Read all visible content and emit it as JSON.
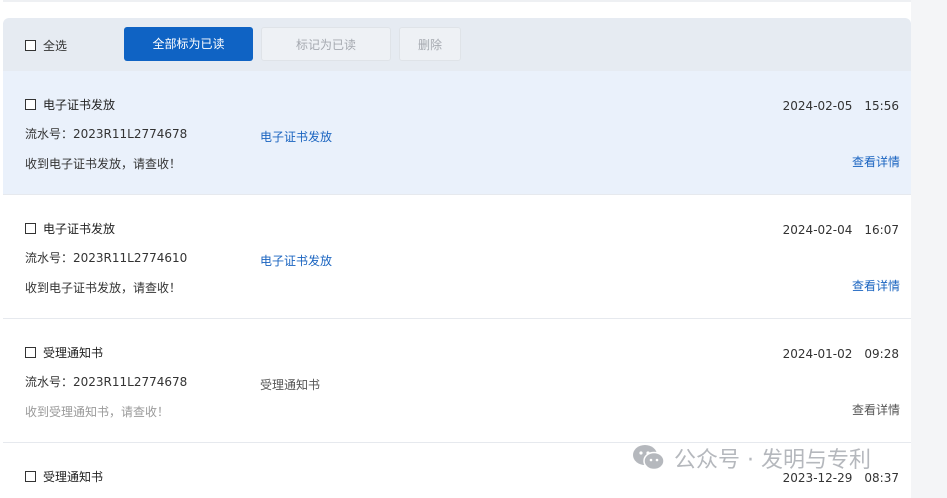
{
  "toolbar": {
    "select_all_label": "全选",
    "mark_all_read_label": "全部标为已读",
    "mark_read_label": "标记为已读",
    "delete_label": "删除"
  },
  "messages": [
    {
      "title": "电子证书发放",
      "serial": "流水号：2023R11L2774678",
      "category": "电子证书发放",
      "body": "收到电子证书发放，请查收！",
      "date": "2024-02-05",
      "time": "15:56",
      "details": "查看详情"
    },
    {
      "title": "电子证书发放",
      "serial": "流水号：2023R11L2774610",
      "category": "电子证书发放",
      "body": "收到电子证书发放，请查收！",
      "date": "2024-02-04",
      "time": "16:07",
      "details": "查看详情"
    },
    {
      "title": "受理通知书",
      "serial": "流水号：2023R11L2774678",
      "category": "受理通知书",
      "body": "收到受理通知书，请查收！",
      "date": "2024-01-02",
      "time": "09:28",
      "details": "查看详情"
    },
    {
      "title": "受理通知书",
      "date": "2023-12-29",
      "time": "08:37"
    }
  ],
  "watermark": {
    "text": "公众号 · 发明与专利",
    "icon": "wechat-icon"
  },
  "colors": {
    "primary": "#0f63c4",
    "link": "#1a64c0",
    "toolbar_bg": "#e6ebf2",
    "highlight_bg": "#eaf1fb"
  }
}
